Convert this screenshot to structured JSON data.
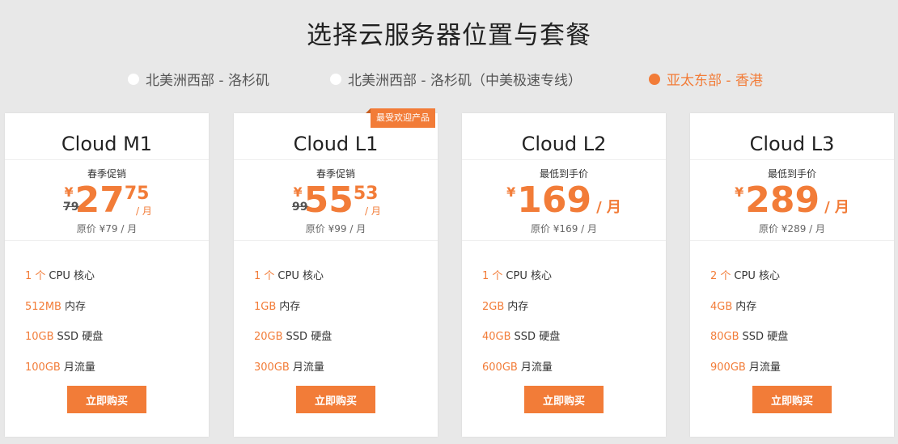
{
  "page_title": "选择云服务器位置与套餐",
  "regions": [
    {
      "label": "北美洲西部 - 洛杉矶",
      "active": false
    },
    {
      "label": "北美洲西部 - 洛杉矶（中美极速专线）",
      "active": true
    },
    {
      "label": "亚太东部 - 香港",
      "active": true
    }
  ],
  "accent_color": "#f27c38",
  "plans": [
    {
      "name": "Cloud M1",
      "promo": "春季促销",
      "currency": "¥",
      "price_int": "27",
      "price_dec": "75",
      "old_price": "79",
      "unit": "/ 月",
      "original_price": "原价 ¥79 / 月",
      "features": [
        {
          "value": "1 个",
          "label": "CPU 核心"
        },
        {
          "value": "512MB",
          "label": "内存"
        },
        {
          "value": "10GB",
          "label": "SSD 硬盘"
        },
        {
          "value": "100GB",
          "label": "月流量"
        }
      ],
      "buy_label": "立即购买"
    },
    {
      "name": "Cloud L1",
      "ribbon": "最受欢迎产品",
      "promo": "春季促销",
      "currency": "¥",
      "price_int": "55",
      "price_dec": "53",
      "old_price": "99",
      "unit": "/ 月",
      "original_price": "原价 ¥99 / 月",
      "features": [
        {
          "value": "1 个",
          "label": "CPU 核心"
        },
        {
          "value": "1GB",
          "label": "内存"
        },
        {
          "value": "20GB",
          "label": "SSD 硬盘"
        },
        {
          "value": "300GB",
          "label": "月流量"
        }
      ],
      "buy_label": "立即购买"
    },
    {
      "name": "Cloud L2",
      "promo": "最低到手价",
      "currency": "¥",
      "price_int": "169",
      "unit": "/ 月",
      "original_price": "原价 ¥169 / 月",
      "features": [
        {
          "value": "1 个",
          "label": "CPU 核心"
        },
        {
          "value": "2GB",
          "label": "内存"
        },
        {
          "value": "40GB",
          "label": "SSD 硬盘"
        },
        {
          "value": "600GB",
          "label": "月流量"
        }
      ],
      "buy_label": "立即购买"
    },
    {
      "name": "Cloud L3",
      "promo": "最低到手价",
      "currency": "¥",
      "price_int": "289",
      "unit": "/ 月",
      "original_price": "原价 ¥289 / 月",
      "features": [
        {
          "value": "2 个",
          "label": "CPU 核心"
        },
        {
          "value": "4GB",
          "label": "内存"
        },
        {
          "value": "80GB",
          "label": "SSD 硬盘"
        },
        {
          "value": "900GB",
          "label": "月流量"
        }
      ],
      "buy_label": "立即购买"
    }
  ]
}
